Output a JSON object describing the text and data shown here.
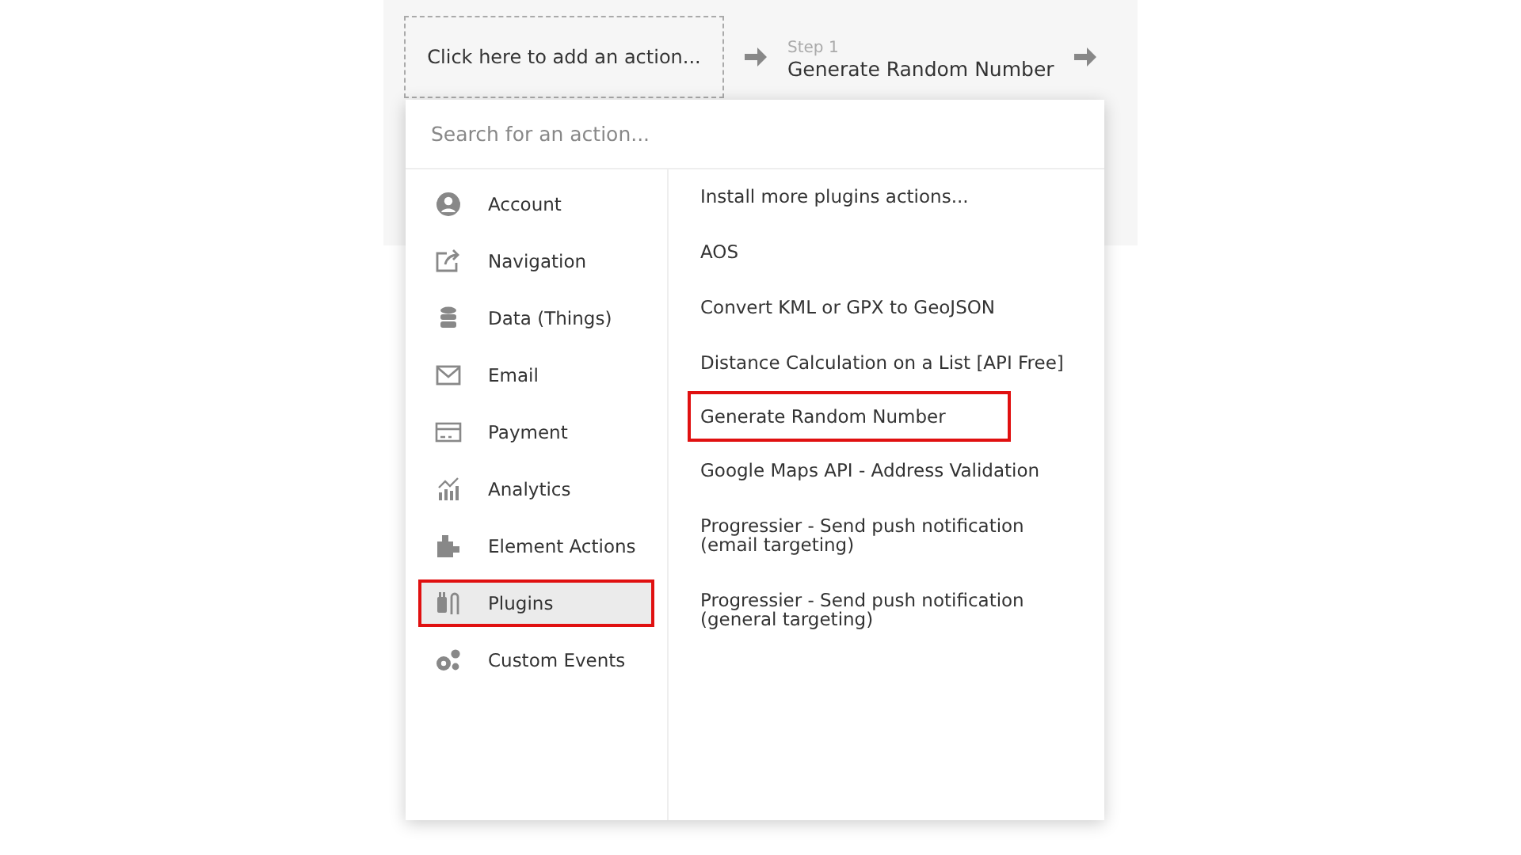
{
  "workflow": {
    "add_action": "Click here to add an action...",
    "step": {
      "label": "Step 1",
      "name": "Generate Random Number"
    }
  },
  "search": {
    "placeholder": "Search for an action..."
  },
  "categories": [
    {
      "label": "Account",
      "selected": false,
      "highlighted": false
    },
    {
      "label": "Navigation",
      "selected": false,
      "highlighted": false
    },
    {
      "label": "Data (Things)",
      "selected": false,
      "highlighted": false
    },
    {
      "label": "Email",
      "selected": false,
      "highlighted": false
    },
    {
      "label": "Payment",
      "selected": false,
      "highlighted": false
    },
    {
      "label": "Analytics",
      "selected": false,
      "highlighted": false
    },
    {
      "label": "Element Actions",
      "selected": false,
      "highlighted": false
    },
    {
      "label": "Plugins",
      "selected": true,
      "highlighted": true
    },
    {
      "label": "Custom Events",
      "selected": false,
      "highlighted": false
    }
  ],
  "actions": [
    {
      "label": "Install more plugins actions...",
      "highlighted": false
    },
    {
      "label": "AOS",
      "highlighted": false
    },
    {
      "label": "Convert KML or GPX to GeoJSON",
      "highlighted": false
    },
    {
      "label": "Distance Calculation on a List [API Free]",
      "highlighted": false
    },
    {
      "label": "Generate Random Number",
      "highlighted": true
    },
    {
      "label": "Google Maps API - Address Validation",
      "highlighted": false
    },
    {
      "label": "Progressier - Send push notification (email targeting)",
      "highlighted": false
    },
    {
      "label": "Progressier - Send push notification (general targeting)",
      "highlighted": false
    }
  ]
}
